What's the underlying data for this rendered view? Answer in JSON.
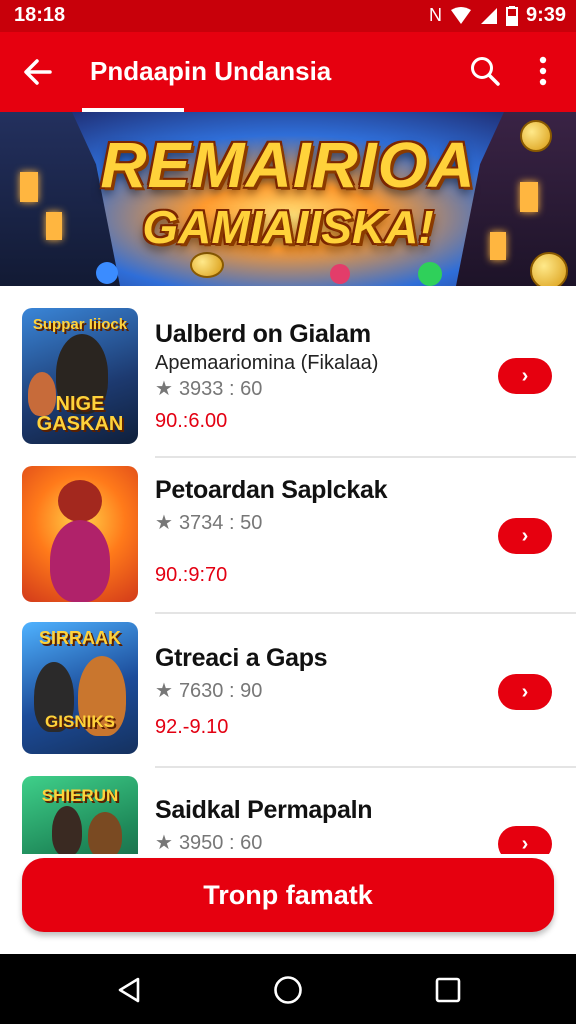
{
  "status_bar": {
    "time": "18:18",
    "clock": "9:39"
  },
  "app_bar": {
    "title": "Pndaapin Undansia"
  },
  "banner": {
    "line1": "REMAIRIOA",
    "line2": "GAMIAIISKA!"
  },
  "items": [
    {
      "title": "Ualberd on Gialam",
      "subtitle": "Apemaariomina (Fikalaa)",
      "rating": "3933 : 60",
      "price": "90.:6.00",
      "thumb_line1": "Suppar Iiiock",
      "thumb_line2": "NIGE GASKAN"
    },
    {
      "title": "Petoardan Saplckak",
      "subtitle": "",
      "rating": "3734 : 50",
      "price": "90.:9:70",
      "thumb_line1": "",
      "thumb_line2": ""
    },
    {
      "title": "Gtreaci a Gaps",
      "subtitle": "",
      "rating": "7630 : 90",
      "price": "92.-9.10",
      "thumb_line1": "SIRRAAK",
      "thumb_line2": "GISNIKS"
    },
    {
      "title": "Saidkal Permapaln",
      "subtitle": "",
      "rating": "3950 : 60",
      "price": "",
      "thumb_line1": "SHIERUN",
      "thumb_line2": ""
    }
  ],
  "cta": {
    "label": "Tronp famatk"
  },
  "colors": {
    "brand_red": "#e6000f",
    "status_red": "#c8000a",
    "price_red": "#e30012"
  },
  "icons": [
    "back-arrow-icon",
    "search-icon",
    "more-vert-icon",
    "star-icon",
    "chevron-right-icon",
    "nav-back-icon",
    "nav-home-icon",
    "nav-recent-icon"
  ]
}
